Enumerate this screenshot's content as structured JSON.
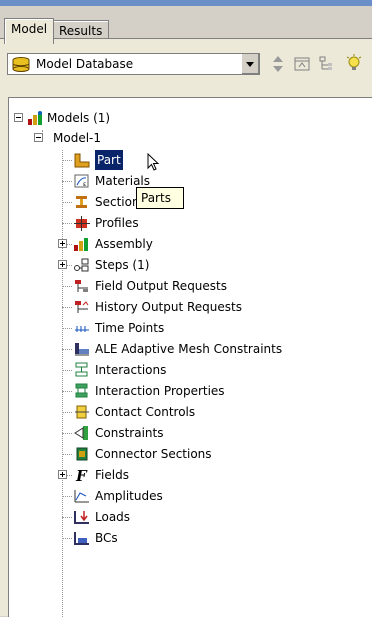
{
  "tabs": [
    {
      "label": "Model",
      "active": true
    },
    {
      "label": "Results",
      "active": false
    }
  ],
  "toolbar": {
    "combo_value": "Model Database",
    "icons": [
      "database-icon",
      "updown-arrows-icon",
      "expand-tree-icon",
      "filter-tree-icon",
      "bulb-icon"
    ]
  },
  "tree": {
    "root": {
      "label": "Models (1)",
      "icon": "models-icon"
    },
    "model": {
      "label": "Model-1"
    },
    "items": [
      {
        "label": "Parts",
        "icon": "part-icon",
        "selected": true
      },
      {
        "label": "Materials",
        "icon": "material-icon"
      },
      {
        "label": "Sections",
        "icon": "section-icon"
      },
      {
        "label": "Profiles",
        "icon": "profile-icon"
      },
      {
        "label": "Assembly",
        "icon": "assembly-icon",
        "expandable": true
      },
      {
        "label": "Steps (1)",
        "icon": "steps-icon",
        "expandable": true
      },
      {
        "label": "Field Output Requests",
        "icon": "field-output-icon"
      },
      {
        "label": "History Output Requests",
        "icon": "history-output-icon"
      },
      {
        "label": "Time Points",
        "icon": "time-points-icon"
      },
      {
        "label": "ALE Adaptive Mesh Constraints",
        "icon": "ale-icon"
      },
      {
        "label": "Interactions",
        "icon": "interactions-icon"
      },
      {
        "label": "Interaction Properties",
        "icon": "interaction-props-icon"
      },
      {
        "label": "Contact Controls",
        "icon": "contact-controls-icon"
      },
      {
        "label": "Constraints",
        "icon": "constraints-icon"
      },
      {
        "label": "Connector Sections",
        "icon": "connector-icon"
      },
      {
        "label": "Fields",
        "icon": "fields-icon",
        "expandable": true
      },
      {
        "label": "Amplitudes",
        "icon": "amplitudes-icon"
      },
      {
        "label": "Loads",
        "icon": "loads-icon"
      },
      {
        "label": "BCs",
        "icon": "bcs-icon"
      }
    ]
  },
  "tooltip": {
    "text": "Parts"
  },
  "colors": {
    "selection": "#0a246a",
    "tooltip_bg": "#ffffe1",
    "panel": "#ece9d8"
  }
}
